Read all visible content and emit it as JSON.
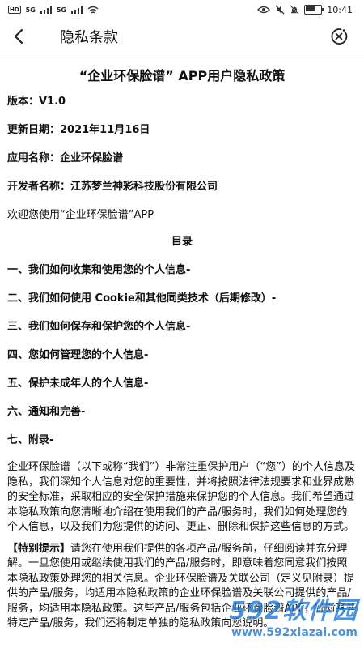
{
  "status_bar": {
    "hd": "HD",
    "network_1": "5G",
    "network_2": "5G",
    "time": "10:41",
    "icons": [
      "hd-badge-icon",
      "signal-icon",
      "signal-icon",
      "wifi-icon",
      "eye-icon",
      "mute-icon",
      "alarm-icon",
      "battery-icon"
    ]
  },
  "header": {
    "title": "隐私条款",
    "back_icon": "chevron-left-icon",
    "close_icon": "close-circle-icon"
  },
  "document": {
    "title": "“企业环保脸谱” APP用户隐私政策",
    "meta": [
      "版本：V1.0",
      "更新日期：2021年11月16日",
      "应用名称：企业环保脸谱",
      "开发者名称：江苏梦兰神彩科技股份有限公司"
    ],
    "welcome": "欢迎您使用“企业环保脸谱”APP",
    "toc_title": "目录",
    "toc": [
      "一、我们如何收集和使用您的个人信息-",
      "二、我们如何使用 Cookie和其他同类技术（后期修改）-",
      "三、我们如何保存和保护您的个人信息-",
      "四、您如何管理您的个人信息-",
      "五、保护未成年人的个人信息-",
      "六、通知和完善-",
      "七、附录-"
    ],
    "intro_paragraph": "企业环保脸谱（以下或称“我们”）非常注重保护用户（“您”）的个人信息及隐私，我们深知个人信息对您的重要性，并将按照法律法规要求和业界成熟的安全标准，采取相应的安全保护措施来保护您的个人信息。我们希望通过本隐私政策向您清晰地介绍在使用我们的产品/服务时，我们如何处理您的个人信息，以及我们为您提供的访问、更正、删除和保护这些信息的方式。",
    "notice_label": "【特别提示】",
    "notice_paragraph": "请您在使用我们提供的各项产品/服务前，仔细阅读并充分理解。一旦您使用或继续使用我们的产品/服务时，即意味着您同意我们按照本隐私政策处理您的相关信息。企业环保脸谱及关联公司（定义见附录）提供的产品/服务，均适用本隐私政策的企业环保脸谱及关联公司提供的产品/服务，均适用本隐私政策。这些产品/服务包括企业环保脸谱APP，针对某些特定产品/服务，我们还将制定单独的隐私政策向您说明。"
  },
  "watermark": {
    "brand": "592软件园",
    "url": "www.592xiazai.com"
  }
}
